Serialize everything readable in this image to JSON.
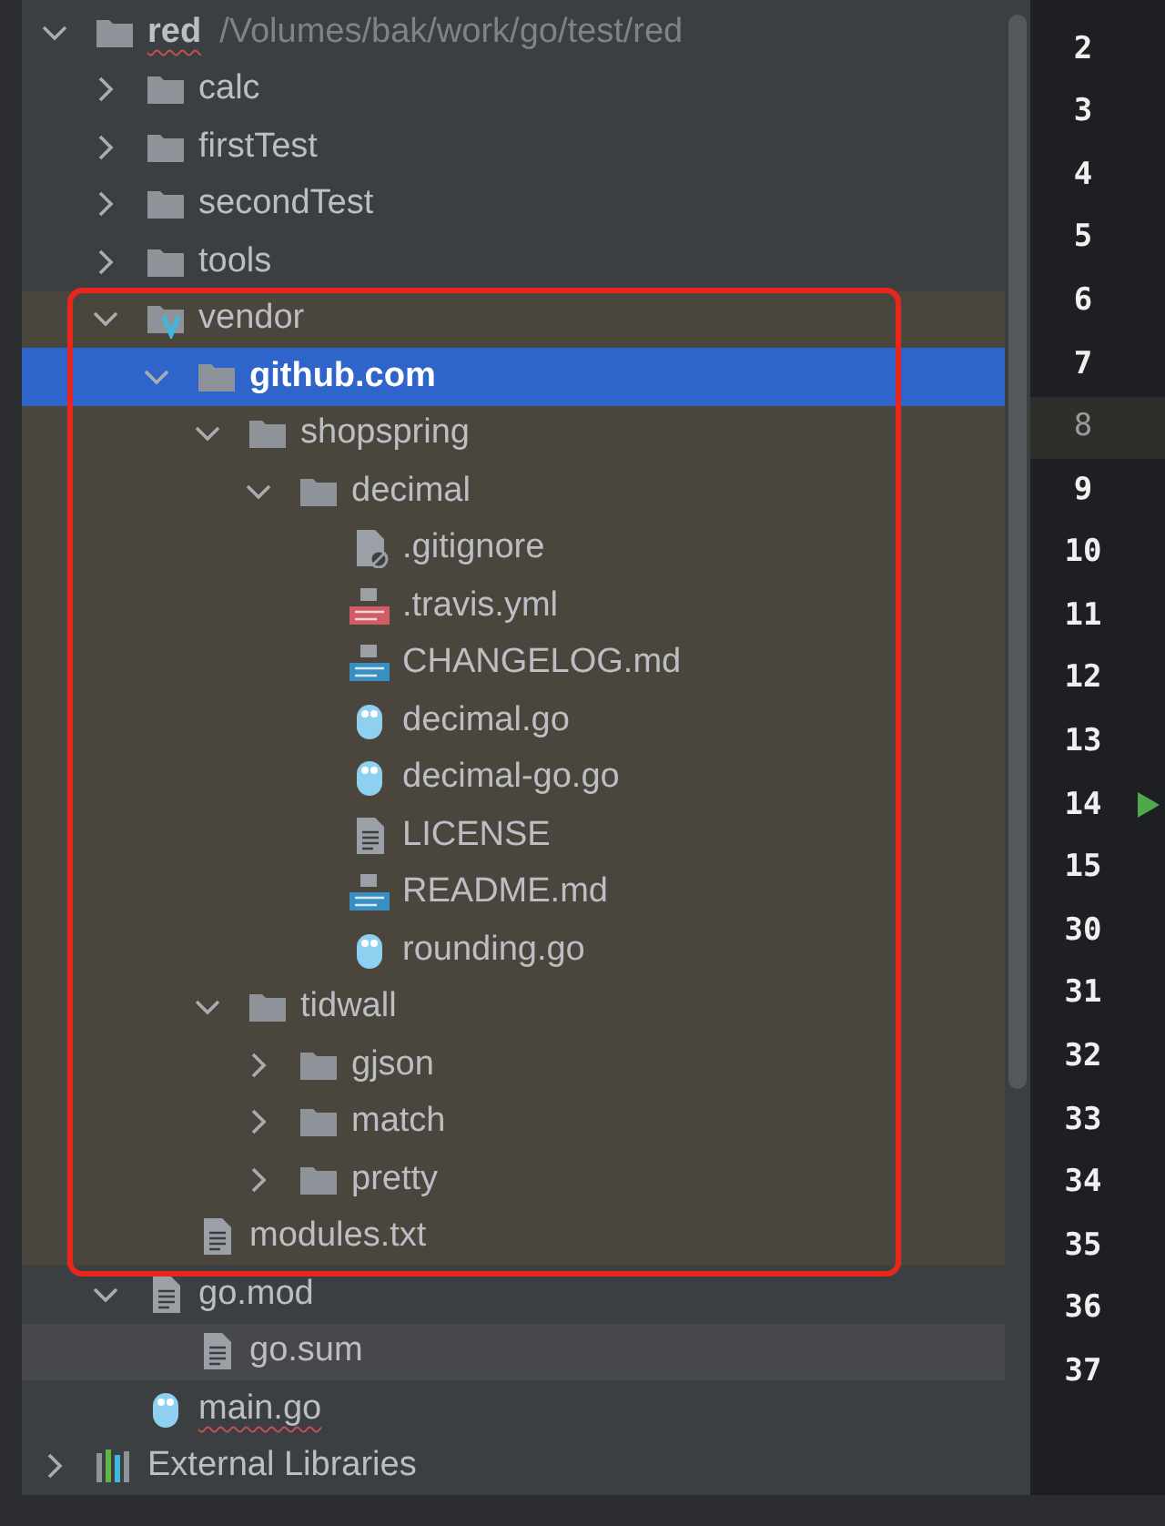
{
  "project_tree": [
    {
      "label": "red",
      "path": "/Volumes/bak/work/go/test/red",
      "kind": "folder",
      "expanded": true,
      "typo": true,
      "children": [
        {
          "label": "calc",
          "kind": "folder",
          "expanded": false
        },
        {
          "label": "firstTest",
          "kind": "folder",
          "expanded": false
        },
        {
          "label": "secondTest",
          "kind": "folder",
          "expanded": false
        },
        {
          "label": "tools",
          "kind": "folder",
          "expanded": false
        },
        {
          "label": "vendor",
          "kind": "vendor-folder",
          "expanded": true,
          "excluded": true,
          "framed": true,
          "children": [
            {
              "label": "github.com",
              "kind": "folder",
              "expanded": true,
              "selected": true,
              "children": [
                {
                  "label": "shopspring",
                  "kind": "folder",
                  "expanded": true,
                  "children": [
                    {
                      "label": "decimal",
                      "kind": "folder",
                      "expanded": true,
                      "children": [
                        {
                          "label": ".gitignore",
                          "kind": "ignore-file"
                        },
                        {
                          "label": ".travis.yml",
                          "kind": "yml-file"
                        },
                        {
                          "label": "CHANGELOG.md",
                          "kind": "md-file"
                        },
                        {
                          "label": "decimal.go",
                          "kind": "go-file"
                        },
                        {
                          "label": "decimal-go.go",
                          "kind": "go-file"
                        },
                        {
                          "label": "LICENSE",
                          "kind": "text-file"
                        },
                        {
                          "label": "README.md",
                          "kind": "md-file"
                        },
                        {
                          "label": "rounding.go",
                          "kind": "go-file"
                        }
                      ]
                    }
                  ]
                },
                {
                  "label": "tidwall",
                  "kind": "folder",
                  "expanded": true,
                  "children": [
                    {
                      "label": "gjson",
                      "kind": "folder",
                      "expanded": false
                    },
                    {
                      "label": "match",
                      "kind": "folder",
                      "expanded": false
                    },
                    {
                      "label": "pretty",
                      "kind": "folder",
                      "expanded": false
                    }
                  ]
                }
              ]
            },
            {
              "label": "modules.txt",
              "kind": "text-file"
            }
          ]
        },
        {
          "label": "go.mod",
          "kind": "text-file",
          "expanded": true,
          "children": [
            {
              "label": "go.sum",
              "kind": "text-file",
              "hovered": true
            }
          ]
        },
        {
          "label": "main.go",
          "kind": "go-file",
          "typo": true
        }
      ]
    },
    {
      "label": "External Libraries",
      "kind": "libraries",
      "expanded": false
    }
  ],
  "gutter": [
    {
      "number": "2"
    },
    {
      "number": "3"
    },
    {
      "number": "4"
    },
    {
      "number": "5"
    },
    {
      "number": "6"
    },
    {
      "number": "7"
    },
    {
      "number": "8",
      "current": true
    },
    {
      "number": "9"
    },
    {
      "number": "10"
    },
    {
      "number": "11"
    },
    {
      "number": "12"
    },
    {
      "number": "13"
    },
    {
      "number": "14",
      "run": true
    },
    {
      "number": "15"
    },
    {
      "number": "30"
    },
    {
      "number": "31"
    },
    {
      "number": "32"
    },
    {
      "number": "33"
    },
    {
      "number": "34"
    },
    {
      "number": "35"
    },
    {
      "number": "36"
    },
    {
      "number": "37"
    }
  ]
}
